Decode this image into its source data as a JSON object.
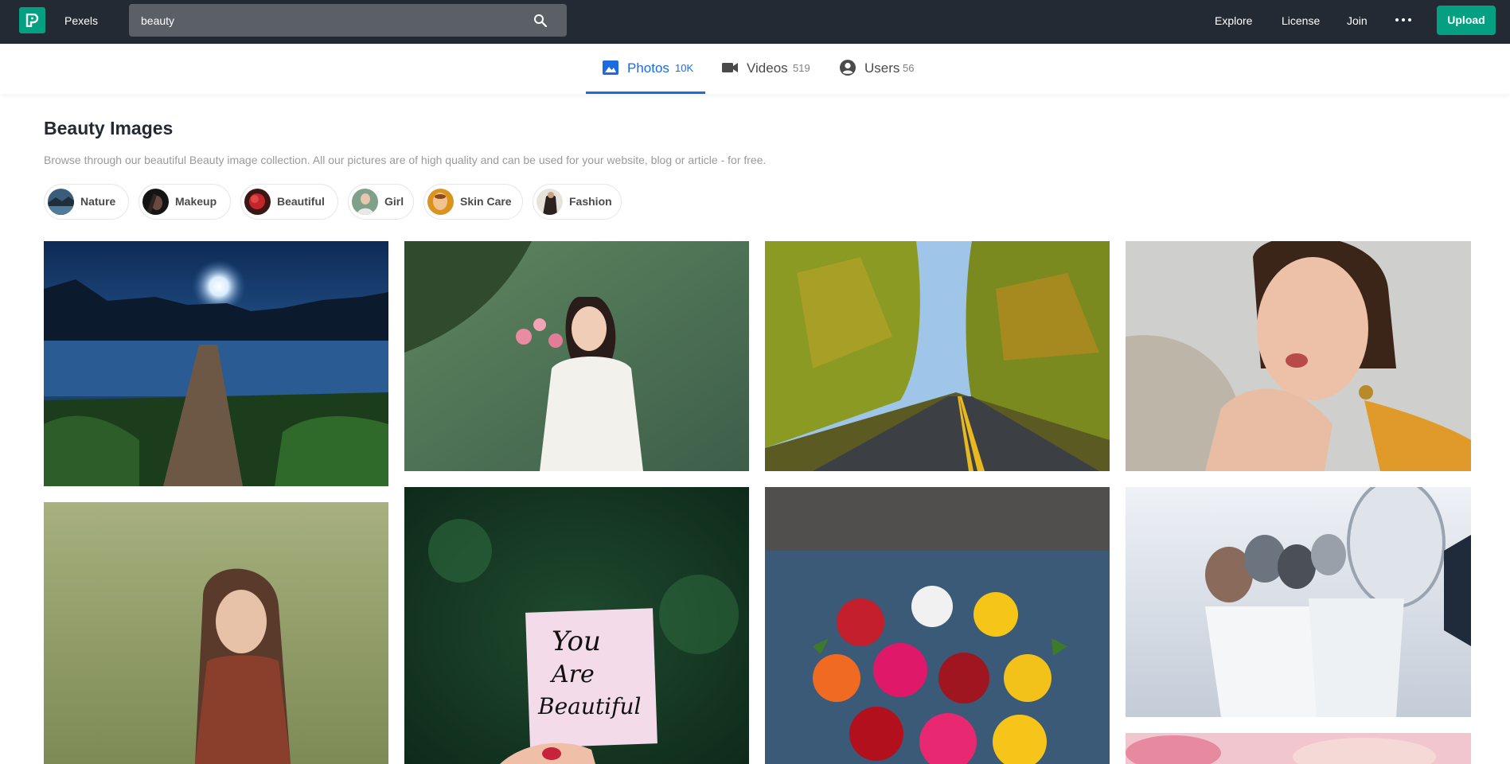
{
  "header": {
    "brand": "Pexels",
    "search": {
      "value": "beauty"
    },
    "nav": {
      "explore": "Explore",
      "license": "License",
      "join": "Join",
      "upload": "Upload"
    }
  },
  "tabs": [
    {
      "label": "Photos",
      "count": "10K",
      "active": true
    },
    {
      "label": "Videos",
      "count": "519",
      "active": false
    },
    {
      "label": "Users",
      "count": "56",
      "active": false
    }
  ],
  "main": {
    "title": "Beauty Images",
    "description": "Browse through our beautiful Beauty image collection. All our pictures are of high quality and can be used for your website, blog or article - for free."
  },
  "chips": [
    {
      "label": "Nature"
    },
    {
      "label": "Makeup"
    },
    {
      "label": "Beautiful"
    },
    {
      "label": "Girl"
    },
    {
      "label": "Skin Care"
    },
    {
      "label": "Fashion"
    }
  ],
  "photos": {
    "note_text": [
      "You",
      "Are",
      "Beautiful"
    ]
  },
  "colors": {
    "topbar": "#232a34",
    "brand_green": "#05a081",
    "active_tab_blue": "#1e6ae0",
    "search_bg": "#5b6067"
  },
  "icons": [
    "pexels-logo-icon",
    "search-icon",
    "more-icon",
    "photo-icon",
    "video-camera-icon",
    "user-icon"
  ]
}
